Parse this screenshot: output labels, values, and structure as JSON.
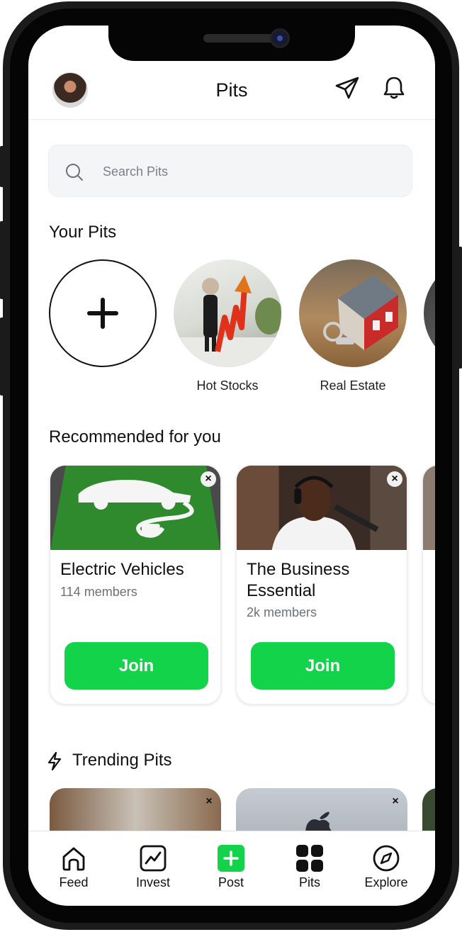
{
  "header": {
    "title": "Pits"
  },
  "search": {
    "placeholder": "Search Pits"
  },
  "your_pits": {
    "title": "Your Pits",
    "items": [
      {
        "label": "Hot Stocks"
      },
      {
        "label": "Real Estate"
      }
    ]
  },
  "recommended": {
    "title": "Recommended for you",
    "cards": [
      {
        "title": "Electric Vehicles",
        "members": "114 members",
        "join_label": "Join"
      },
      {
        "title": "The Business Essential",
        "members": "2k members",
        "join_label": "Join"
      }
    ]
  },
  "trending": {
    "title": "Trending Pits"
  },
  "nav": {
    "items": [
      {
        "label": "Feed",
        "icon": "home-icon"
      },
      {
        "label": "Invest",
        "icon": "chart-icon"
      },
      {
        "label": "Post",
        "icon": "plus-square-icon"
      },
      {
        "label": "Pits",
        "icon": "grid-icon"
      },
      {
        "label": "Explore",
        "icon": "compass-icon"
      }
    ]
  },
  "colors": {
    "accent": "#12d34a"
  }
}
